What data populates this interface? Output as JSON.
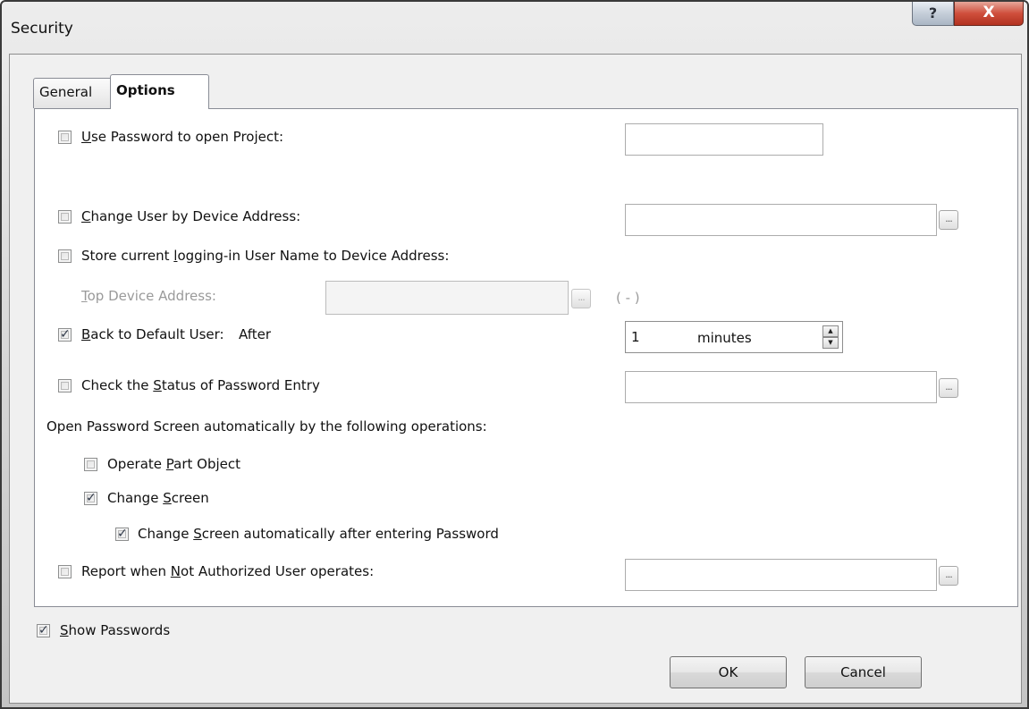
{
  "window": {
    "title": "Security",
    "help_glyph": "?",
    "close_glyph": "X"
  },
  "tabs": [
    {
      "label": "General",
      "active": false
    },
    {
      "label": "Options",
      "active": true
    }
  ],
  "options": {
    "use_password": {
      "pre": "",
      "u": "U",
      "post": "se Password to open Project:",
      "checked": false,
      "value": ""
    },
    "change_user": {
      "pre": "",
      "u": "C",
      "post": "hange User by Device Address:",
      "checked": false,
      "value": ""
    },
    "store_user": {
      "pre": "Store current ",
      "u": "l",
      "post": "ogging-in User Name to Device Address:",
      "checked": false
    },
    "top_device": {
      "pre": "",
      "u": "T",
      "post": "op Device Address:",
      "value": "",
      "range": "( - )"
    },
    "back_default": {
      "pre": "",
      "u": "B",
      "post": "ack to Default User:",
      "after": "After",
      "checked": true,
      "value": "1",
      "unit": "minutes"
    },
    "check_status": {
      "pre": "Check the ",
      "u": "S",
      "post": "tatus of Password Entry",
      "checked": false,
      "value": ""
    },
    "open_screen_heading": "Open Password Screen automatically by the following operations:",
    "operate_part": {
      "pre": "Operate ",
      "u": "P",
      "post": "art Object",
      "checked": false
    },
    "change_screen": {
      "pre": "Change ",
      "u": "S",
      "post": "creen",
      "checked": true
    },
    "change_screen_auto": {
      "pre": "Change ",
      "u": "S",
      "post": "creen automatically after entering Password",
      "checked": true
    },
    "report": {
      "pre": "Report when ",
      "u": "N",
      "post": "ot Authorized User operates:",
      "checked": false,
      "value": ""
    }
  },
  "show_passwords": {
    "pre": "",
    "u": "S",
    "post": "how Passwords",
    "checked": true
  },
  "browse_label": "...",
  "check_glyph": "✓",
  "spin_up": "▲",
  "spin_down": "▼",
  "buttons": {
    "ok": "OK",
    "cancel": "Cancel"
  }
}
